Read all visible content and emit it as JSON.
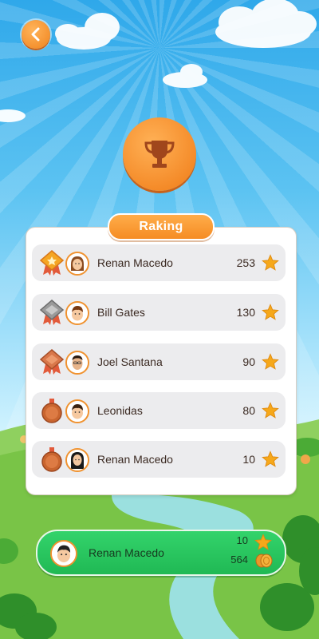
{
  "colors": {
    "accent": "#f58c24",
    "player_bar": "#2ac85e",
    "row_bg": "#ececee",
    "star": "#f6a81a"
  },
  "nav": {
    "back_icon": "chevron-left-icon"
  },
  "header": {
    "icon": "trophy-icon"
  },
  "panel": {
    "title": "Raking"
  },
  "ranking": [
    {
      "rank_icon": "gold-medal-icon",
      "name": "Renan Macedo",
      "score": "253",
      "avatar": "girl-avatar"
    },
    {
      "rank_icon": "silver-medal-icon",
      "name": "Bill Gates",
      "score": "130",
      "avatar": "boy-avatar"
    },
    {
      "rank_icon": "bronze-medal-icon",
      "name": "Joel Santana",
      "score": "90",
      "avatar": "man-avatar"
    },
    {
      "rank_icon": "bronze-coin-medal-icon",
      "name": "Leonidas",
      "score": "80",
      "avatar": "boy-avatar"
    },
    {
      "rank_icon": "bronze-coin-medal-icon",
      "name": "Renan Macedo",
      "score": "10",
      "avatar": "woman-avatar"
    }
  ],
  "player": {
    "name": "Renan Macedo",
    "stars": "10",
    "coins": "564",
    "avatar": "boy-avatar"
  }
}
